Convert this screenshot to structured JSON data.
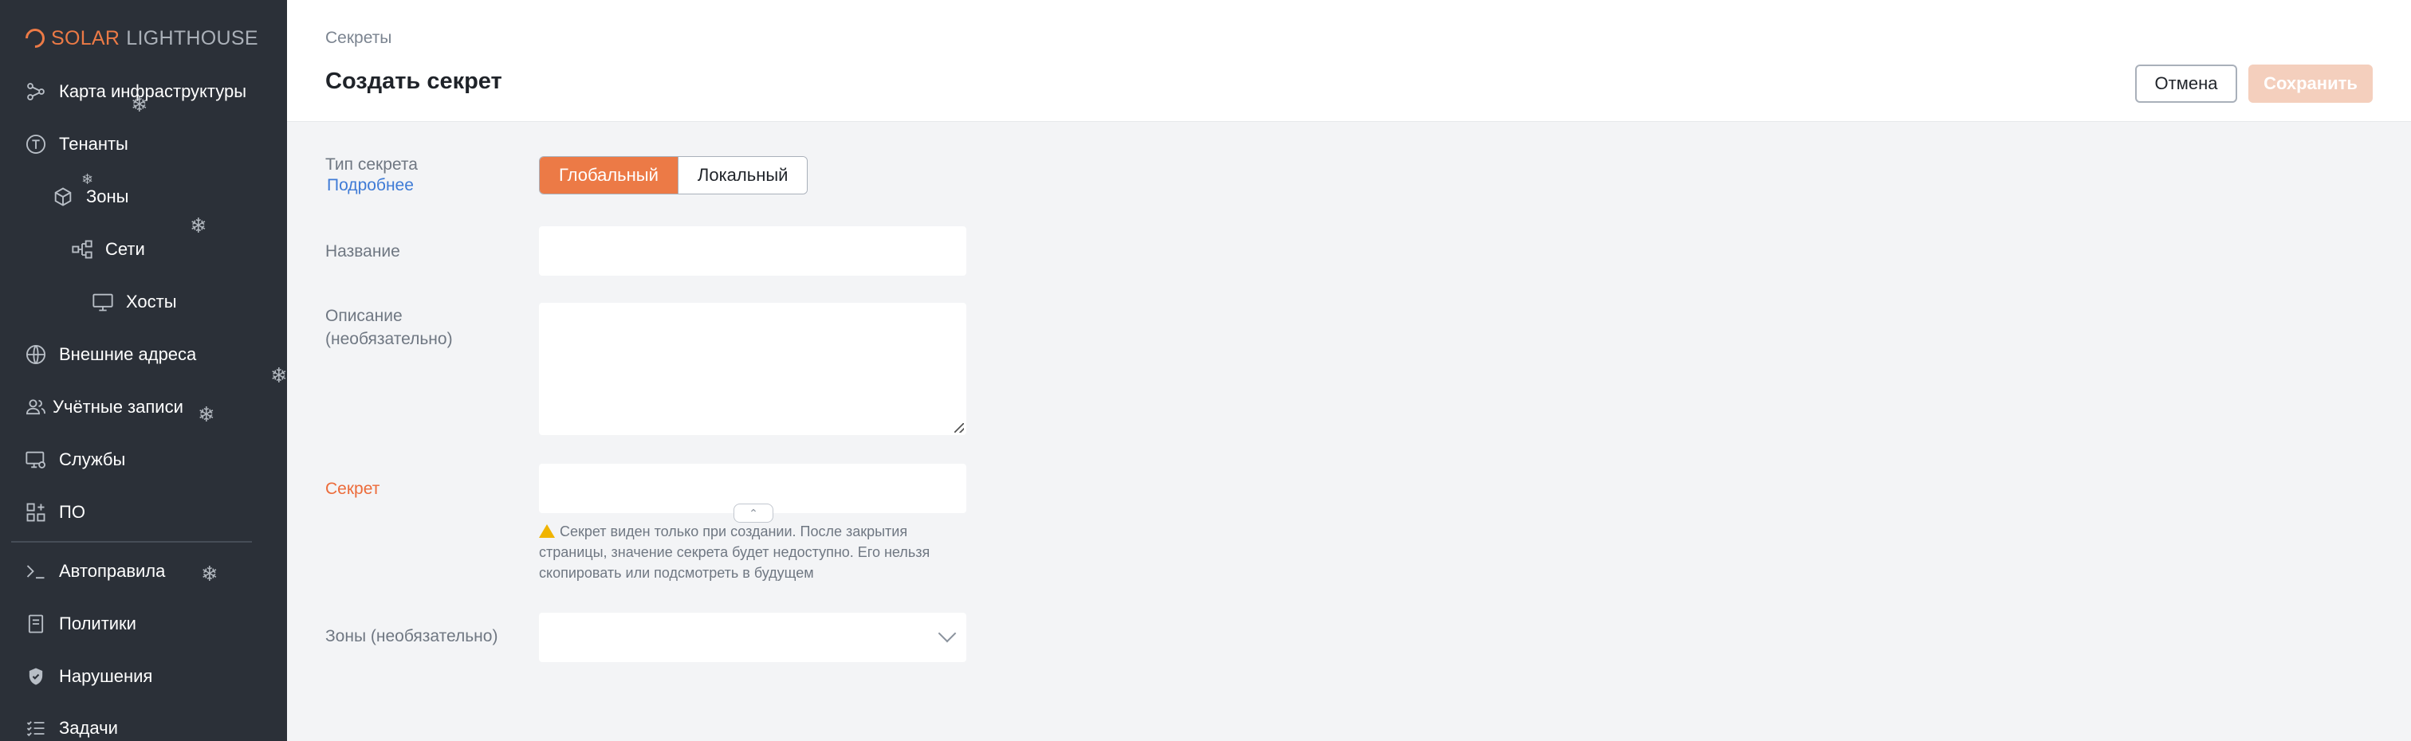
{
  "sidebar": {
    "logo": {
      "brand": "SOLAR",
      "product": "LIGHTHOUSE"
    },
    "items": [
      {
        "label": "Карта инфраструктуры",
        "icon": "share-nodes-icon"
      },
      {
        "label": "Тенанты",
        "icon": "tenant-t-icon"
      },
      {
        "label": "Зоны",
        "icon": "cube-icon"
      },
      {
        "label": "Сети",
        "icon": "network-icon"
      },
      {
        "label": "Хосты",
        "icon": "monitor-icon"
      },
      {
        "label": "Внешние адреса",
        "icon": "globe-icon"
      },
      {
        "label": "Учётные записи",
        "icon": "users-icon"
      },
      {
        "label": "Службы",
        "icon": "service-monitor-icon"
      },
      {
        "label": "ПО",
        "icon": "apps-grid-icon"
      },
      {
        "label": "Автоправила",
        "icon": "terminal-icon"
      },
      {
        "label": "Политики",
        "icon": "document-icon"
      },
      {
        "label": "Нарушения",
        "icon": "shield-icon"
      },
      {
        "label": "Задачи",
        "icon": "checklist-icon"
      }
    ]
  },
  "header": {
    "breadcrumb": "Секреты",
    "title": "Создать секрет",
    "cancel_label": "Отмена",
    "save_label": "Сохранить"
  },
  "form": {
    "secret_type": {
      "label": "Тип секрета",
      "more_link": "Подробнее",
      "options": [
        "Глобальный",
        "Локальный"
      ],
      "selected": "Глобальный"
    },
    "name": {
      "label": "Название",
      "value": ""
    },
    "description": {
      "label_line1": "Описание",
      "label_line2": "(необязательно)",
      "value": ""
    },
    "secret": {
      "label": "Секрет",
      "value": "",
      "hint": "Секрет виден только при создании. После закрытия страницы, значение секрета будет недоступно. Его нельзя скопировать или подсмотреть в будущем"
    },
    "zones": {
      "label": "Зоны (необязательно)",
      "value": ""
    }
  },
  "colors": {
    "accent": "#ec7a46",
    "sidebar_bg": "#2b3038",
    "link": "#3f7bd6",
    "save_disabled": "#f4cfbd"
  }
}
